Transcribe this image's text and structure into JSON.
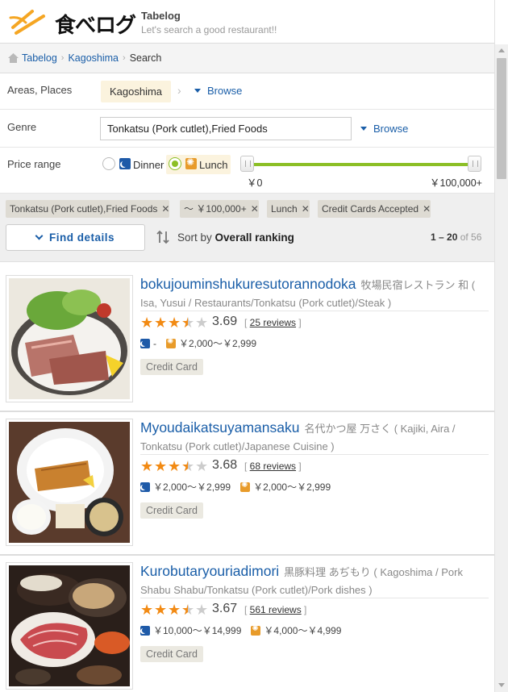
{
  "header": {
    "logo_text": "食べログ",
    "site_name": "Tabelog",
    "tagline": "Let's search a good restaurant!!"
  },
  "breadcrumb": {
    "items": [
      "Tabelog",
      "Kagoshima"
    ],
    "current": "Search"
  },
  "filters": {
    "area": {
      "label": "Areas, Places",
      "value": "Kagoshima",
      "browse": "Browse"
    },
    "genre": {
      "label": "Genre",
      "value": "Tonkatsu (Pork cutlet),Fried Foods",
      "browse": "Browse"
    },
    "price": {
      "label": "Price range",
      "dinner": "Dinner",
      "lunch": "Lunch",
      "selected": "Lunch",
      "min_label": "￥0",
      "max_label": "￥100,000+",
      "range_fraction": [
        0.0,
        1.0
      ]
    }
  },
  "tags": [
    "Tonkatsu (Pork cutlet),Fried Foods",
    "～ ￥100,000+",
    "Lunch",
    "Credit Cards Accepted"
  ],
  "toolbar": {
    "find_details": "Find details",
    "sort_prefix": "Sort by",
    "sort_value": "Overall ranking",
    "count_range": "1 – 20",
    "count_of": "of 56"
  },
  "results": [
    {
      "name": "bokujouminshukuresutorannodoka",
      "subtitle": "牧場民宿レストラン 和 ( Isa, Yusui / Restaurants/Tonkatsu (Pork cutlet)/Steak )",
      "rating": "3.69",
      "stars": 3.5,
      "reviews": "25 reviews",
      "dinner_price": "-",
      "lunch_price": "￥2,000～￥2,999",
      "badge": "Credit Card"
    },
    {
      "name": "Myoudaikatsuyamansaku",
      "subtitle": "名代かつ屋 万さく ( Kajiki, Aira / Tonkatsu (Pork cutlet)/Japanese Cuisine )",
      "rating": "3.68",
      "stars": 3.5,
      "reviews": "68 reviews",
      "dinner_price": "￥2,000～￥2,999",
      "lunch_price": "￥2,000～￥2,999",
      "badge": "Credit Card"
    },
    {
      "name": "Kurobutaryouriadimori",
      "subtitle": "黒豚料理 あぢもり ( Kagoshima / Pork Shabu Shabu/Tonkatsu (Pork cutlet)/Pork dishes )",
      "rating": "3.67",
      "stars": 3.5,
      "reviews": "561 reviews",
      "dinner_price": "￥10,000～￥14,999",
      "lunch_price": "￥4,000～￥4,999",
      "badge": "Credit Card"
    }
  ],
  "colors": {
    "link": "#1a5ea8",
    "star": "#f28a13",
    "slider": "#8cbf26",
    "chip_bg": "#fbf3de"
  }
}
